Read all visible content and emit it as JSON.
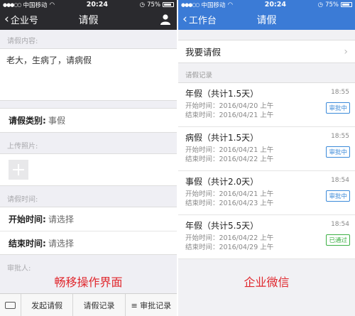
{
  "left": {
    "status": {
      "carrier": "中国移动",
      "time": "20:24",
      "battery": "75%"
    },
    "nav": {
      "back": "企业号",
      "title": "请假"
    },
    "content_label": "请假内容:",
    "content_value": "老大，生病了，请病假",
    "type": {
      "label": "请假类别:",
      "value": "事假"
    },
    "photo_label": "上传照片:",
    "time_label": "请假时间:",
    "start": {
      "label": "开始时间:",
      "value": "请选择"
    },
    "end": {
      "label": "结束时间:",
      "value": "请选择"
    },
    "approver_label": "审批人:",
    "caption": "畅移操作界面",
    "tabs": [
      "发起请假",
      "请假记录",
      "≡ 审批记录"
    ]
  },
  "right": {
    "status": {
      "carrier": "中国移动",
      "time": "20:24",
      "battery": "75%"
    },
    "nav": {
      "back": "工作台",
      "title": "请假"
    },
    "apply_label": "我要请假",
    "records_label": "请假记录",
    "records": [
      {
        "title": "年假（共计1.5天）",
        "start": "开始时间：2016/04/20 上午",
        "end": "结束时间：2016/04/21 上午",
        "time": "18:55",
        "badge": "审批中"
      },
      {
        "title": "病假（共计1.5天）",
        "start": "开始时间：2016/04/21 上午",
        "end": "结束时间：2016/04/22 上午",
        "time": "18:55",
        "badge": "审批中"
      },
      {
        "title": "事假（共计2.0天）",
        "start": "开始时间：2016/04/21 上午",
        "end": "结束时间：2016/04/23 上午",
        "time": "18:54",
        "badge": "审批中"
      },
      {
        "title": "年假（共计5.5天）",
        "start": "开始时间：2016/04/22 上午",
        "end": "结束时间：2016/04/29 上午",
        "time": "18:54",
        "badge": "已通过"
      }
    ],
    "caption": "企业微信"
  },
  "colors": {
    "pending": "#3b8ad9",
    "approved": "#3cb044",
    "caption": "#e0272d"
  }
}
